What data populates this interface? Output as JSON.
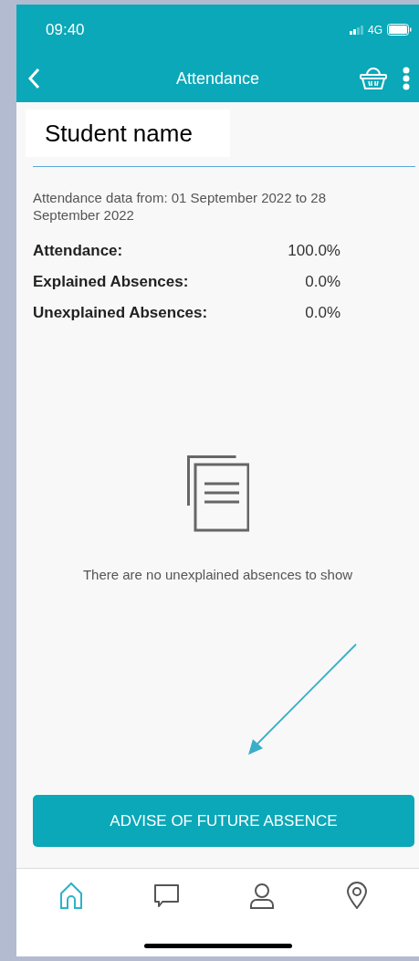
{
  "status_bar": {
    "time": "09:40",
    "network": "4G"
  },
  "nav_bar": {
    "title": "Attendance"
  },
  "student": {
    "name": "Student name"
  },
  "date_range": "Attendance data from: 01 September 2022 to 28 September 2022",
  "stats": [
    {
      "label": "Attendance:",
      "value": "100.0%"
    },
    {
      "label": "Explained Absences:",
      "value": "0.0%"
    },
    {
      "label": "Unexplained Absences:",
      "value": "0.0%"
    }
  ],
  "empty_message": "There are no unexplained absences to show",
  "action_button": "ADVISE OF FUTURE ABSENCE",
  "tab_bar": [
    {
      "kind": "home",
      "selected": true
    },
    {
      "kind": "chat",
      "selected": false
    },
    {
      "kind": "profile",
      "selected": false
    },
    {
      "kind": "location",
      "selected": false
    }
  ]
}
